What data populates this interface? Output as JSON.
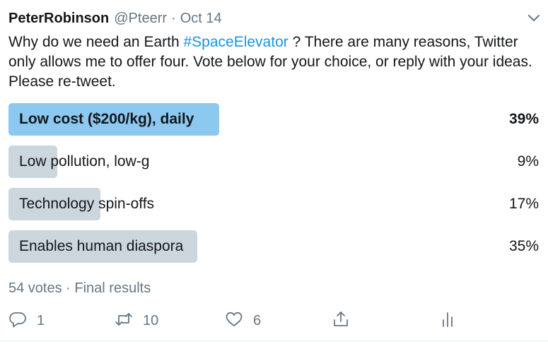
{
  "tweet": {
    "author_name": "PeterRobinson",
    "handle": "@Pteerr",
    "separator": "·",
    "date": "Oct 14",
    "text_before": "Why do we need an Earth ",
    "hashtag": "#SpaceElevator",
    "text_after": " ? There are many reasons, Twitter only allows me to offer four.  Vote below for your choice, or reply with your ideas.  Please re-tweet."
  },
  "poll": {
    "options": [
      {
        "label": "Low cost ($200/kg), daily",
        "percent_label": "39%",
        "percent": 39,
        "winner": true
      },
      {
        "label": "Low pollution, low-g",
        "percent_label": "9%",
        "percent": 9,
        "winner": false
      },
      {
        "label": "Technology spin-offs",
        "percent_label": "17%",
        "percent": 17,
        "winner": false
      },
      {
        "label": "Enables human diaspora",
        "percent_label": "35%",
        "percent": 35,
        "winner": false
      }
    ],
    "summary": "54 votes · Final results"
  },
  "actions": {
    "reply_count": "1",
    "retweet_count": "10",
    "like_count": "6"
  },
  "colors": {
    "winner_bar": "#8dc8f0",
    "bar": "#ccd6dd",
    "link": "#1b95e0",
    "muted": "#657786"
  },
  "icons": [
    "chevron-down-icon",
    "reply-icon",
    "retweet-icon",
    "like-icon",
    "share-icon",
    "analytics-icon"
  ]
}
